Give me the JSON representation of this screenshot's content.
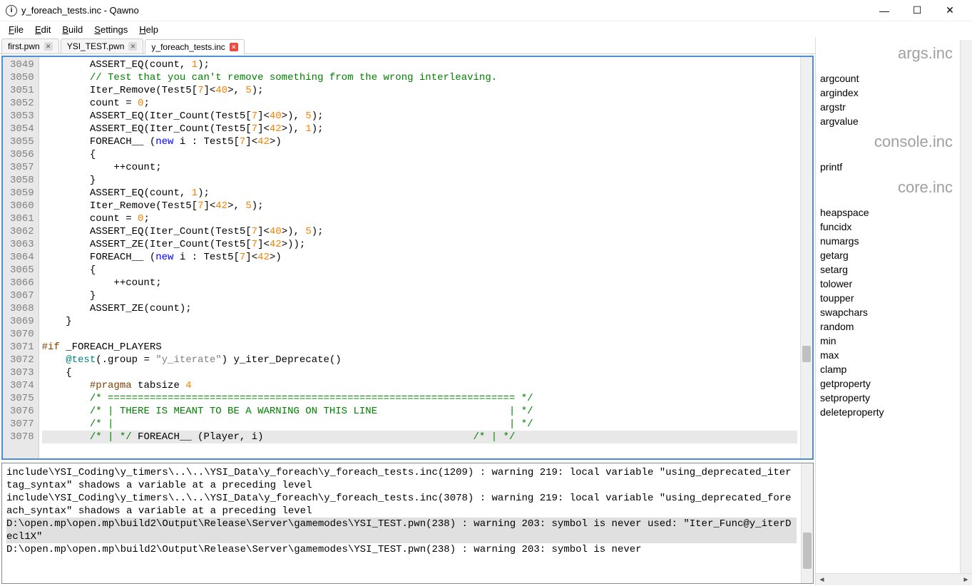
{
  "window": {
    "title": "y_foreach_tests.inc - Qawno",
    "icon_glyph": "i"
  },
  "menu": {
    "file": "File",
    "edit": "Edit",
    "build": "Build",
    "settings": "Settings",
    "help": "Help"
  },
  "tabs": [
    {
      "label": "first.pwn",
      "dirty": false,
      "active": false
    },
    {
      "label": "YSI_TEST.pwn",
      "dirty": false,
      "active": false
    },
    {
      "label": "y_foreach_tests.inc",
      "dirty": true,
      "active": true
    }
  ],
  "editor": {
    "first_line_number": 3049,
    "caret_line_index": 29,
    "scroll_thumb": {
      "top_pct": 72,
      "height_pct": 4
    },
    "lines": [
      {
        "segs": [
          [
            "        ",
            ""
          ],
          [
            "ASSERT_EQ(count, ",
            ""
          ],
          [
            "1",
            "number"
          ],
          [
            ");",
            ""
          ]
        ]
      },
      {
        "segs": [
          [
            "        ",
            ""
          ],
          [
            "// Test that you can't remove something from the wrong interleaving.",
            "comment"
          ]
        ]
      },
      {
        "segs": [
          [
            "        ",
            ""
          ],
          [
            "Iter_Remove(Test5[",
            ""
          ],
          [
            "7",
            "number"
          ],
          [
            "]<",
            ""
          ],
          [
            "40",
            "number"
          ],
          [
            ">, ",
            ""
          ],
          [
            "5",
            "number"
          ],
          [
            ");",
            ""
          ]
        ]
      },
      {
        "segs": [
          [
            "        ",
            ""
          ],
          [
            "count = ",
            ""
          ],
          [
            "0",
            "number"
          ],
          [
            ";",
            ""
          ]
        ]
      },
      {
        "segs": [
          [
            "        ",
            ""
          ],
          [
            "ASSERT_EQ(Iter_Count(Test5[",
            ""
          ],
          [
            "7",
            "number"
          ],
          [
            "]<",
            ""
          ],
          [
            "40",
            "number"
          ],
          [
            ">), ",
            ""
          ],
          [
            "5",
            "number"
          ],
          [
            ");",
            ""
          ]
        ]
      },
      {
        "segs": [
          [
            "        ",
            ""
          ],
          [
            "ASSERT_EQ(Iter_Count(Test5[",
            ""
          ],
          [
            "7",
            "number"
          ],
          [
            "]<",
            ""
          ],
          [
            "42",
            "number"
          ],
          [
            ">), ",
            ""
          ],
          [
            "1",
            "number"
          ],
          [
            ");",
            ""
          ]
        ]
      },
      {
        "segs": [
          [
            "        ",
            ""
          ],
          [
            "FOREACH__ (",
            ""
          ],
          [
            "new",
            "keyword"
          ],
          [
            " i : Test5[",
            ""
          ],
          [
            "7",
            "number"
          ],
          [
            "]<",
            ""
          ],
          [
            "42",
            "number"
          ],
          [
            ">)",
            ""
          ]
        ]
      },
      {
        "segs": [
          [
            "        {",
            ""
          ]
        ]
      },
      {
        "segs": [
          [
            "            ++count;",
            ""
          ]
        ]
      },
      {
        "segs": [
          [
            "        }",
            ""
          ]
        ]
      },
      {
        "segs": [
          [
            "        ",
            ""
          ],
          [
            "ASSERT_EQ(count, ",
            ""
          ],
          [
            "1",
            "number"
          ],
          [
            ");",
            ""
          ]
        ]
      },
      {
        "segs": [
          [
            "        ",
            ""
          ],
          [
            "Iter_Remove(Test5[",
            ""
          ],
          [
            "7",
            "number"
          ],
          [
            "]<",
            ""
          ],
          [
            "42",
            "number"
          ],
          [
            ">, ",
            ""
          ],
          [
            "5",
            "number"
          ],
          [
            ");",
            ""
          ]
        ]
      },
      {
        "segs": [
          [
            "        ",
            ""
          ],
          [
            "count = ",
            ""
          ],
          [
            "0",
            "number"
          ],
          [
            ";",
            ""
          ]
        ]
      },
      {
        "segs": [
          [
            "        ",
            ""
          ],
          [
            "ASSERT_EQ(Iter_Count(Test5[",
            ""
          ],
          [
            "7",
            "number"
          ],
          [
            "]<",
            ""
          ],
          [
            "40",
            "number"
          ],
          [
            ">), ",
            ""
          ],
          [
            "5",
            "number"
          ],
          [
            ");",
            ""
          ]
        ]
      },
      {
        "segs": [
          [
            "        ",
            ""
          ],
          [
            "ASSERT_ZE(Iter_Count(Test5[",
            ""
          ],
          [
            "7",
            "number"
          ],
          [
            "]<",
            ""
          ],
          [
            "42",
            "number"
          ],
          [
            ">));",
            ""
          ]
        ]
      },
      {
        "segs": [
          [
            "        ",
            ""
          ],
          [
            "FOREACH__ (",
            ""
          ],
          [
            "new",
            "keyword"
          ],
          [
            " i : Test5[",
            ""
          ],
          [
            "7",
            "number"
          ],
          [
            "]<",
            ""
          ],
          [
            "42",
            "number"
          ],
          [
            ">)",
            ""
          ]
        ]
      },
      {
        "segs": [
          [
            "        {",
            ""
          ]
        ]
      },
      {
        "segs": [
          [
            "            ++count;",
            ""
          ]
        ]
      },
      {
        "segs": [
          [
            "        }",
            ""
          ]
        ]
      },
      {
        "segs": [
          [
            "        ",
            ""
          ],
          [
            "ASSERT_ZE(count);",
            ""
          ]
        ]
      },
      {
        "segs": [
          [
            "    }",
            ""
          ]
        ]
      },
      {
        "segs": [
          [
            "",
            ""
          ]
        ]
      },
      {
        "segs": [
          [
            "#if",
            "preproc"
          ],
          [
            " _FOREACH_PLAYERS",
            ""
          ]
        ]
      },
      {
        "segs": [
          [
            "    ",
            ""
          ],
          [
            "@test",
            "annot"
          ],
          [
            "(.group = ",
            ""
          ],
          [
            "\"y_iterate\"",
            "string"
          ],
          [
            ") y_iter_Deprecate()",
            ""
          ]
        ]
      },
      {
        "segs": [
          [
            "    {",
            ""
          ]
        ]
      },
      {
        "segs": [
          [
            "        ",
            ""
          ],
          [
            "#pragma",
            "preproc"
          ],
          [
            " tabsize ",
            ""
          ],
          [
            "4",
            "number"
          ]
        ]
      },
      {
        "segs": [
          [
            "        ",
            ""
          ],
          [
            "/* ==================================================================== */",
            "comment"
          ]
        ]
      },
      {
        "segs": [
          [
            "        ",
            ""
          ],
          [
            "/* | THERE IS MEANT TO BE A WARNING ON THIS LINE                      | */",
            "comment"
          ]
        ]
      },
      {
        "segs": [
          [
            "        ",
            ""
          ],
          [
            "/* |                                                                  | */",
            "comment"
          ]
        ]
      },
      {
        "segs": [
          [
            "        ",
            ""
          ],
          [
            "/* | */",
            "comment"
          ],
          [
            " FOREACH__ (Player, i)                                   ",
            ""
          ],
          [
            "/* | */",
            "comment"
          ]
        ]
      }
    ]
  },
  "output": {
    "scroll_thumb": {
      "top_pct": 58,
      "height_pct": 30
    },
    "highlight_index": 2,
    "lines": [
      "include\\YSI_Coding\\y_timers\\..\\..\\YSI_Data\\y_foreach\\y_foreach_tests.inc(1209) : warning 219: local variable \"using_deprecated_itertag_syntax\" shadows a variable at a preceding level",
      "include\\YSI_Coding\\y_timers\\..\\..\\YSI_Data\\y_foreach\\y_foreach_tests.inc(3078) : warning 219: local variable \"using_deprecated_foreach_syntax\" shadows a variable at a preceding level",
      "D:\\open.mp\\open.mp\\build2\\Output\\Release\\Server\\gamemodes\\YSI_TEST.pwn(238) : warning 203: symbol is never used: \"Iter_Func@y_iterDecl1X\"",
      "D:\\open.mp\\open.mp\\build2\\Output\\Release\\Server\\gamemodes\\YSI_TEST.pwn(238) : warning 203: symbol is never "
    ]
  },
  "sidepanel": {
    "sections": [
      {
        "header": "args.inc",
        "items": [
          "argcount",
          "argindex",
          "argstr",
          "argvalue"
        ]
      },
      {
        "header": "console.inc",
        "items": [
          "printf"
        ]
      },
      {
        "header": "core.inc",
        "items": [
          "heapspace",
          "funcidx",
          "numargs",
          "getarg",
          "setarg",
          "tolower",
          "toupper",
          "swapchars",
          "random",
          "min",
          "max",
          "clamp",
          "getproperty",
          "setproperty",
          "deleteproperty"
        ]
      }
    ]
  }
}
